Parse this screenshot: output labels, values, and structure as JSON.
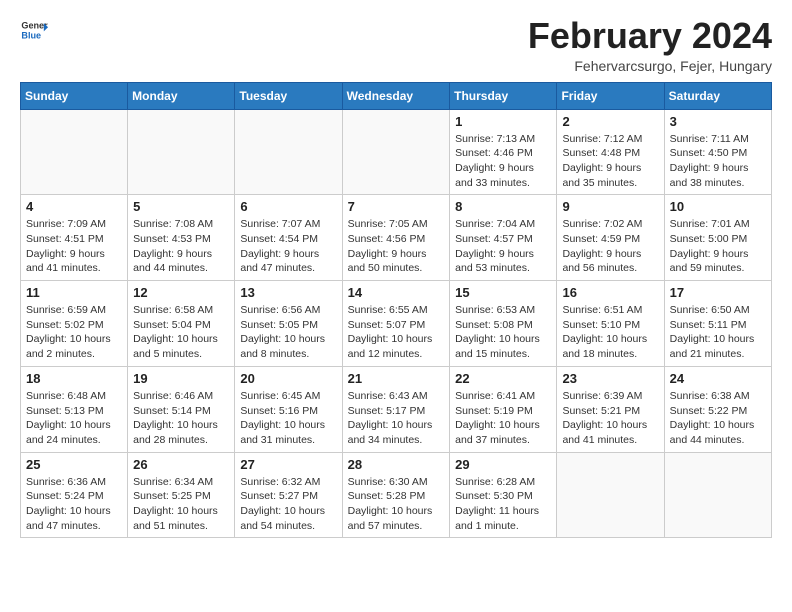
{
  "logo": {
    "general": "General",
    "blue": "Blue"
  },
  "title": "February 2024",
  "location": "Fehervarcsurgo, Fejer, Hungary",
  "weekdays": [
    "Sunday",
    "Monday",
    "Tuesday",
    "Wednesday",
    "Thursday",
    "Friday",
    "Saturday"
  ],
  "weeks": [
    [
      {
        "day": "",
        "info": ""
      },
      {
        "day": "",
        "info": ""
      },
      {
        "day": "",
        "info": ""
      },
      {
        "day": "",
        "info": ""
      },
      {
        "day": "1",
        "info": "Sunrise: 7:13 AM\nSunset: 4:46 PM\nDaylight: 9 hours\nand 33 minutes."
      },
      {
        "day": "2",
        "info": "Sunrise: 7:12 AM\nSunset: 4:48 PM\nDaylight: 9 hours\nand 35 minutes."
      },
      {
        "day": "3",
        "info": "Sunrise: 7:11 AM\nSunset: 4:50 PM\nDaylight: 9 hours\nand 38 minutes."
      }
    ],
    [
      {
        "day": "4",
        "info": "Sunrise: 7:09 AM\nSunset: 4:51 PM\nDaylight: 9 hours\nand 41 minutes."
      },
      {
        "day": "5",
        "info": "Sunrise: 7:08 AM\nSunset: 4:53 PM\nDaylight: 9 hours\nand 44 minutes."
      },
      {
        "day": "6",
        "info": "Sunrise: 7:07 AM\nSunset: 4:54 PM\nDaylight: 9 hours\nand 47 minutes."
      },
      {
        "day": "7",
        "info": "Sunrise: 7:05 AM\nSunset: 4:56 PM\nDaylight: 9 hours\nand 50 minutes."
      },
      {
        "day": "8",
        "info": "Sunrise: 7:04 AM\nSunset: 4:57 PM\nDaylight: 9 hours\nand 53 minutes."
      },
      {
        "day": "9",
        "info": "Sunrise: 7:02 AM\nSunset: 4:59 PM\nDaylight: 9 hours\nand 56 minutes."
      },
      {
        "day": "10",
        "info": "Sunrise: 7:01 AM\nSunset: 5:00 PM\nDaylight: 9 hours\nand 59 minutes."
      }
    ],
    [
      {
        "day": "11",
        "info": "Sunrise: 6:59 AM\nSunset: 5:02 PM\nDaylight: 10 hours\nand 2 minutes."
      },
      {
        "day": "12",
        "info": "Sunrise: 6:58 AM\nSunset: 5:04 PM\nDaylight: 10 hours\nand 5 minutes."
      },
      {
        "day": "13",
        "info": "Sunrise: 6:56 AM\nSunset: 5:05 PM\nDaylight: 10 hours\nand 8 minutes."
      },
      {
        "day": "14",
        "info": "Sunrise: 6:55 AM\nSunset: 5:07 PM\nDaylight: 10 hours\nand 12 minutes."
      },
      {
        "day": "15",
        "info": "Sunrise: 6:53 AM\nSunset: 5:08 PM\nDaylight: 10 hours\nand 15 minutes."
      },
      {
        "day": "16",
        "info": "Sunrise: 6:51 AM\nSunset: 5:10 PM\nDaylight: 10 hours\nand 18 minutes."
      },
      {
        "day": "17",
        "info": "Sunrise: 6:50 AM\nSunset: 5:11 PM\nDaylight: 10 hours\nand 21 minutes."
      }
    ],
    [
      {
        "day": "18",
        "info": "Sunrise: 6:48 AM\nSunset: 5:13 PM\nDaylight: 10 hours\nand 24 minutes."
      },
      {
        "day": "19",
        "info": "Sunrise: 6:46 AM\nSunset: 5:14 PM\nDaylight: 10 hours\nand 28 minutes."
      },
      {
        "day": "20",
        "info": "Sunrise: 6:45 AM\nSunset: 5:16 PM\nDaylight: 10 hours\nand 31 minutes."
      },
      {
        "day": "21",
        "info": "Sunrise: 6:43 AM\nSunset: 5:17 PM\nDaylight: 10 hours\nand 34 minutes."
      },
      {
        "day": "22",
        "info": "Sunrise: 6:41 AM\nSunset: 5:19 PM\nDaylight: 10 hours\nand 37 minutes."
      },
      {
        "day": "23",
        "info": "Sunrise: 6:39 AM\nSunset: 5:21 PM\nDaylight: 10 hours\nand 41 minutes."
      },
      {
        "day": "24",
        "info": "Sunrise: 6:38 AM\nSunset: 5:22 PM\nDaylight: 10 hours\nand 44 minutes."
      }
    ],
    [
      {
        "day": "25",
        "info": "Sunrise: 6:36 AM\nSunset: 5:24 PM\nDaylight: 10 hours\nand 47 minutes."
      },
      {
        "day": "26",
        "info": "Sunrise: 6:34 AM\nSunset: 5:25 PM\nDaylight: 10 hours\nand 51 minutes."
      },
      {
        "day": "27",
        "info": "Sunrise: 6:32 AM\nSunset: 5:27 PM\nDaylight: 10 hours\nand 54 minutes."
      },
      {
        "day": "28",
        "info": "Sunrise: 6:30 AM\nSunset: 5:28 PM\nDaylight: 10 hours\nand 57 minutes."
      },
      {
        "day": "29",
        "info": "Sunrise: 6:28 AM\nSunset: 5:30 PM\nDaylight: 11 hours\nand 1 minute."
      },
      {
        "day": "",
        "info": ""
      },
      {
        "day": "",
        "info": ""
      }
    ]
  ]
}
